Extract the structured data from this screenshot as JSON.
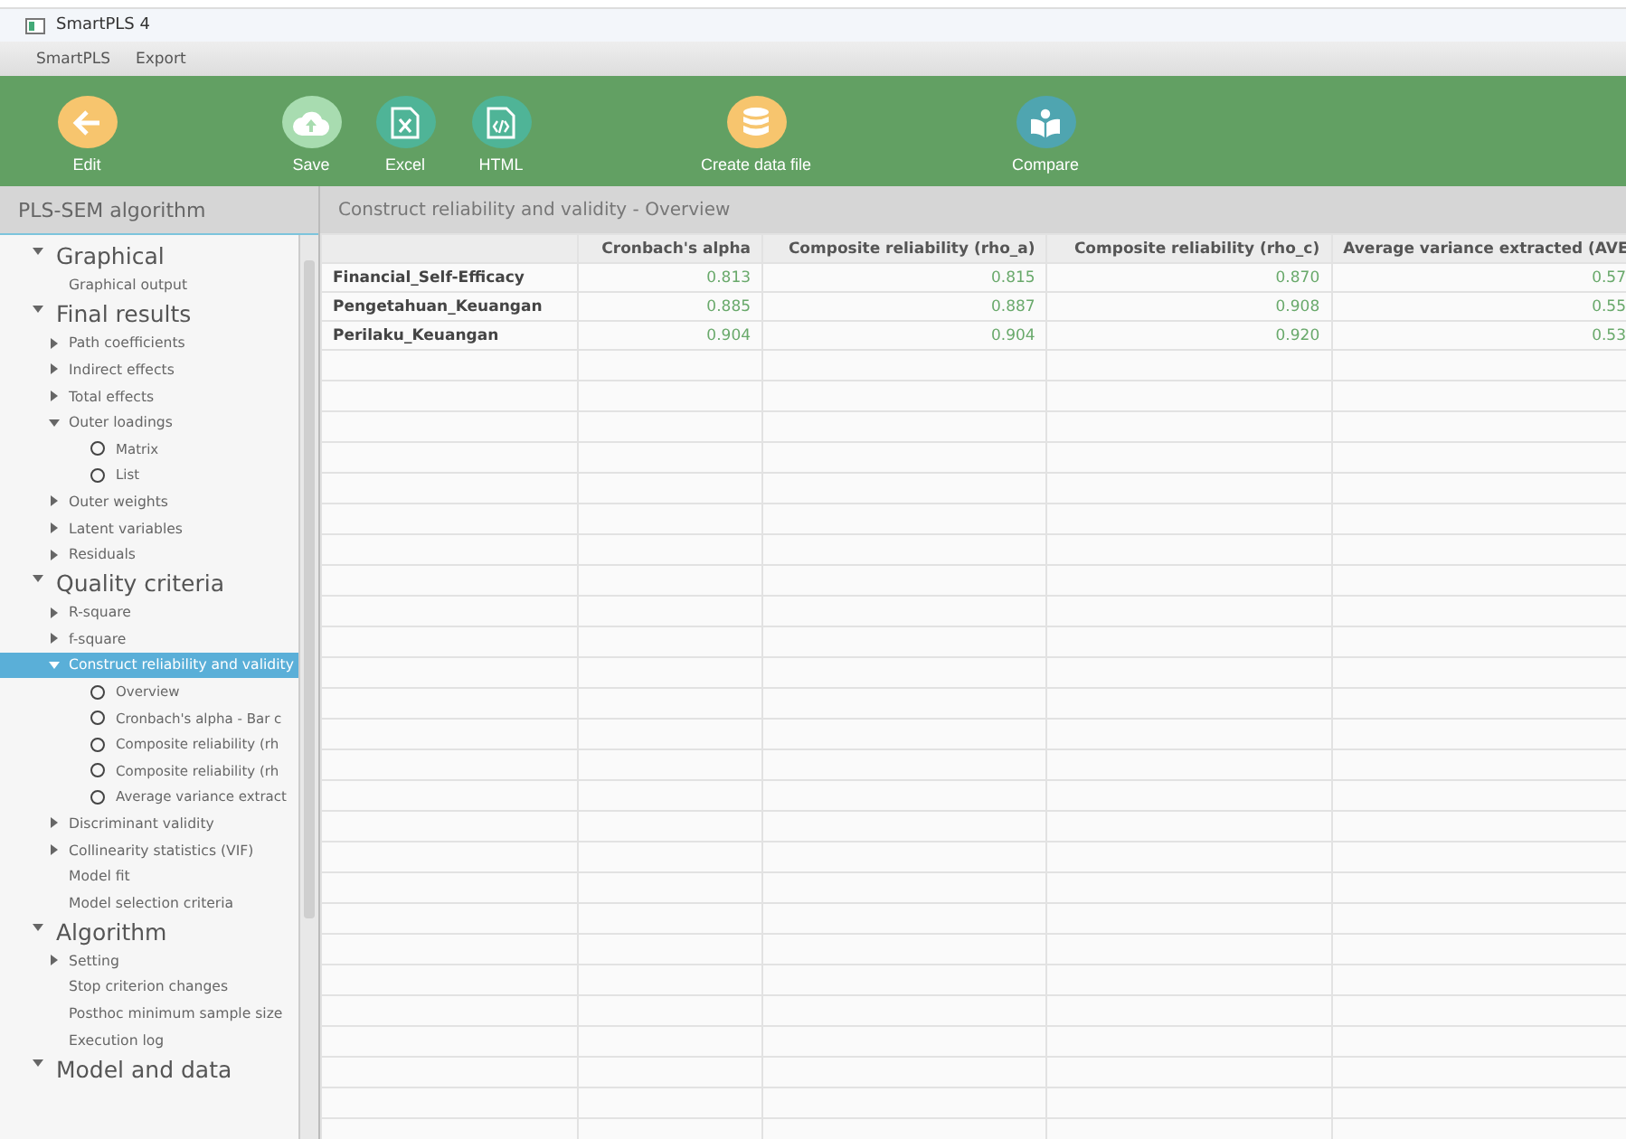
{
  "window": {
    "title": "SmartPLS 4"
  },
  "menu": [
    "SmartPLS",
    "Export"
  ],
  "toolbar": [
    {
      "label": "Edit",
      "kind": "back",
      "color": "#f7c56e"
    },
    {
      "label": "Save",
      "kind": "cloud",
      "color": "#a8dcb0"
    },
    {
      "label": "Excel",
      "kind": "excel",
      "color": "#4fb497"
    },
    {
      "label": "HTML",
      "kind": "html",
      "color": "#4fb497"
    },
    {
      "label": "Create data file",
      "kind": "database",
      "color": "#f7c56e"
    },
    {
      "label": "Compare",
      "kind": "book",
      "color": "#4fa5b0"
    }
  ],
  "sidebar": {
    "title": "PLS-SEM algorithm",
    "tree": [
      {
        "kind": "group",
        "label": "Graphical",
        "expanded": true,
        "children": [
          {
            "kind": "leaf",
            "label": "Graphical output",
            "selected": false
          }
        ]
      },
      {
        "kind": "group",
        "label": "Final results",
        "expanded": true,
        "children": [
          {
            "kind": "branch",
            "label": "Path coefficients",
            "expanded": false,
            "selected": false
          },
          {
            "kind": "branch",
            "label": "Indirect effects",
            "expanded": false,
            "selected": false
          },
          {
            "kind": "branch",
            "label": "Total effects",
            "expanded": false,
            "selected": false
          },
          {
            "kind": "branch",
            "label": "Outer loadings",
            "expanded": true,
            "selected": false,
            "children": [
              {
                "kind": "radio",
                "label": "Matrix",
                "checked": false
              },
              {
                "kind": "radio",
                "label": "List",
                "checked": false
              }
            ]
          },
          {
            "kind": "branch",
            "label": "Outer weights",
            "expanded": false,
            "selected": false
          },
          {
            "kind": "branch",
            "label": "Latent variables",
            "expanded": false,
            "selected": false
          },
          {
            "kind": "branch",
            "label": "Residuals",
            "expanded": false,
            "selected": false
          }
        ]
      },
      {
        "kind": "group",
        "label": "Quality criteria",
        "expanded": true,
        "children": [
          {
            "kind": "branch",
            "label": "R-square",
            "expanded": false,
            "selected": false
          },
          {
            "kind": "branch",
            "label": "f-square",
            "expanded": false,
            "selected": false
          },
          {
            "kind": "branch",
            "label": "Construct reliability and validity",
            "expanded": true,
            "selected": true,
            "children": [
              {
                "kind": "radio",
                "label": "Overview",
                "checked": false
              },
              {
                "kind": "radio",
                "label": "Cronbach's alpha - Bar c",
                "checked": false
              },
              {
                "kind": "radio",
                "label": "Composite reliability (rh",
                "checked": false
              },
              {
                "kind": "radio",
                "label": "Composite reliability (rh",
                "checked": false
              },
              {
                "kind": "radio",
                "label": "Average variance extract",
                "checked": false
              }
            ]
          },
          {
            "kind": "branch",
            "label": "Discriminant validity",
            "expanded": false,
            "selected": false
          },
          {
            "kind": "branch",
            "label": "Collinearity statistics (VIF)",
            "expanded": false,
            "selected": false
          },
          {
            "kind": "leaf",
            "label": "Model fit",
            "selected": false
          },
          {
            "kind": "leaf",
            "label": "Model selection criteria",
            "selected": false
          }
        ]
      },
      {
        "kind": "group",
        "label": "Algorithm",
        "expanded": true,
        "children": [
          {
            "kind": "branch",
            "label": "Setting",
            "expanded": false,
            "selected": false
          },
          {
            "kind": "leaf",
            "label": "Stop criterion changes",
            "selected": false
          },
          {
            "kind": "leaf",
            "label": "Posthoc minimum sample size",
            "selected": false
          },
          {
            "kind": "leaf",
            "label": "Execution log",
            "selected": false
          }
        ]
      },
      {
        "kind": "group",
        "label": "Model and data",
        "expanded": true
      }
    ]
  },
  "results": {
    "title": "Construct reliability and validity - Overview",
    "columns": [
      "",
      "Cronbach's alpha",
      "Composite reliability (rho_a)",
      "Composite reliability (rho_c)",
      "Average variance extracted (AVE"
    ],
    "rows": [
      [
        "Financial_Self-Efficacy",
        "0.813",
        "0.815",
        "0.870",
        "0.57"
      ],
      [
        "Pengetahuan_Keuangan",
        "0.885",
        "0.887",
        "0.908",
        "0.55"
      ],
      [
        "Perilaku_Keuangan",
        "0.904",
        "0.904",
        "0.920",
        "0.53"
      ]
    ]
  }
}
